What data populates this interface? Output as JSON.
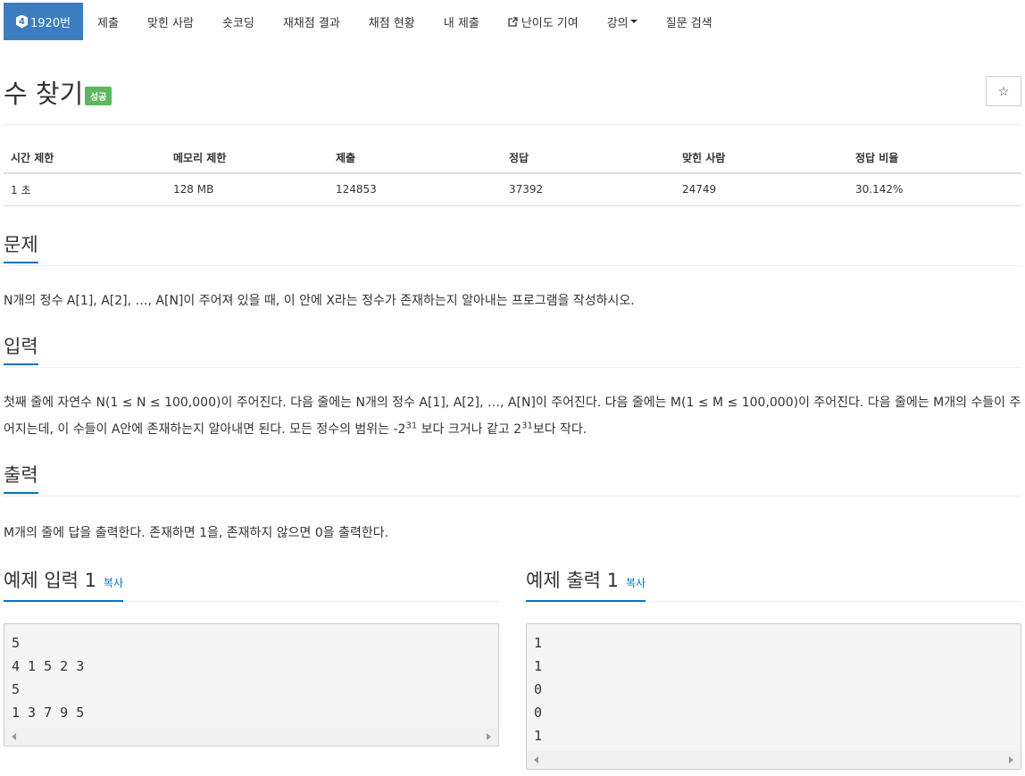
{
  "nav": {
    "problem_tier": "4",
    "problem_number": "1920번",
    "items": [
      "제출",
      "맞힌 사람",
      "숏코딩",
      "재채점 결과",
      "채점 현황",
      "내 제출",
      "난이도 기여",
      "강의",
      "질문 검색"
    ]
  },
  "problem": {
    "title": "수 찾기",
    "result": "성공",
    "star": "☆"
  },
  "info_table": {
    "headers": [
      "시간 제한",
      "메모리 제한",
      "제출",
      "정답",
      "맞힌 사람",
      "정답 비율"
    ],
    "values": [
      "1 초",
      "128 MB",
      "124853",
      "37392",
      "24749",
      "30.142%"
    ]
  },
  "sections": {
    "description": {
      "heading": "문제",
      "text": "N개의 정수 A[1], A[2], …, A[N]이 주어져 있을 때, 이 안에 X라는 정수가 존재하는지 알아내는 프로그램을 작성하시오."
    },
    "input": {
      "heading": "입력",
      "text_main": "첫째 줄에 자연수 N(1 ≤ N ≤ 100,000)이 주어진다. 다음 줄에는 N개의 정수 A[1], A[2], …, A[N]이 주어진다. 다음 줄에는 M(1 ≤ M ≤ 100,000)이 주어진다. 다음 줄에는 M개의 수들이 주어지는데, 이 수들이 A안에 존재하는지 알아내면 된다. 모든 정수의 범위는 -2",
      "exp1": "31",
      "text_mid": " 보다 크거나 같고 2",
      "exp2": "31",
      "text_end": "보다 작다."
    },
    "output": {
      "heading": "출력",
      "text": "M개의 줄에 답을 출력한다. 존재하면 1을, 존재하지 않으면 0을 출력한다."
    }
  },
  "samples": {
    "input": {
      "heading": "예제 입력 1",
      "copy_label": "복사",
      "content": "5\n4 1 5 2 3\n5\n1 3 7 9 5"
    },
    "output": {
      "heading": "예제 출력 1",
      "copy_label": "복사",
      "content": "1\n1\n0\n0\n1"
    }
  }
}
